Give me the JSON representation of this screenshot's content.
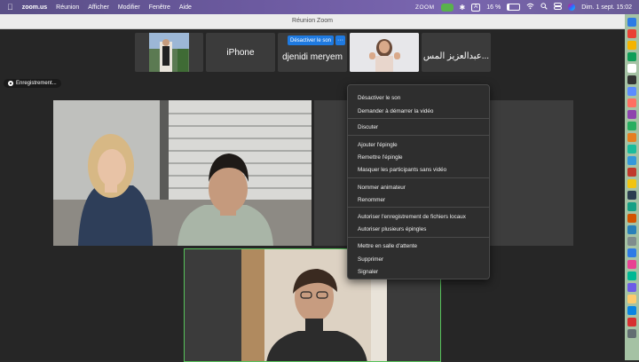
{
  "menubar": {
    "app": "zoom.us",
    "items": [
      "Réunion",
      "Afficher",
      "Modifier",
      "Fenêtre",
      "Aide"
    ],
    "zoom_label": "ZOOM",
    "input_badge": "A",
    "battery": "16 %",
    "datetime": "Dim. 1 sept. 15:02"
  },
  "window": {
    "title": "Réunion Zoom"
  },
  "thumbnails": {
    "t2_name": "iPhone",
    "t3_name": "djenidi meryem",
    "t5_name": "عبدالعزيز المس...",
    "mute_button": "Désactiver le son",
    "more_button": "···"
  },
  "recording": {
    "label": "Enregistrement..."
  },
  "context_menu": {
    "items": [
      "Désactiver le son",
      "Demander à démarrer la vidéo",
      "Discuter",
      "Ajouter l'épingle",
      "Remettre l'épingle",
      "Masquer les participants sans vidéo",
      "Nommer animateur",
      "Renommer",
      "Autoriser l'enregistrement de fichiers locaux",
      "Autoriser plusieurs épingles",
      "Mettre en salle d'attente",
      "Supprimer",
      "Signaler"
    ]
  },
  "colors": {
    "active_speaker_border": "#56c25a",
    "accent_blue": "#1f7ae0",
    "menu_bg": "#2e2e2e"
  },
  "icons": [
    "apple-icon",
    "zoom-status-icon",
    "bluetooth-icon",
    "input-source-icon",
    "wifi-icon",
    "search-icon",
    "control-center-icon",
    "siri-icon",
    "more-icon",
    "record-icon"
  ]
}
